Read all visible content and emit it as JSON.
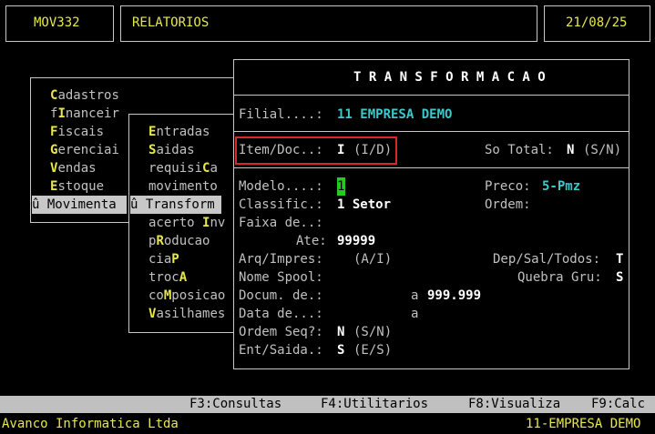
{
  "header": {
    "program": "MOV332",
    "module": "RELATORIOS",
    "date": "21/08/25"
  },
  "menu1": {
    "items": [
      {
        "hot": "C",
        "rest": "adastros"
      },
      {
        "pre": "f",
        "hot": "I",
        "rest": "nanceir"
      },
      {
        "hot": "F",
        "rest": "iscais"
      },
      {
        "hot": "G",
        "rest": "erenciai"
      },
      {
        "hot": "V",
        "rest": "endas"
      },
      {
        "hot": "E",
        "rest": "stoque"
      }
    ],
    "selected": "û Movimenta"
  },
  "menu2": {
    "items": [
      {
        "hot": "E",
        "rest": "ntradas"
      },
      {
        "hot": "S",
        "rest": "aidas"
      },
      {
        "pre": "requisi",
        "hot": "C",
        "rest": "a"
      },
      {
        "pre": "movimento",
        "hot": "",
        "rest": ""
      }
    ],
    "selected": "û Transform",
    "items_after": [
      {
        "pre": "acerto ",
        "hot": "I",
        "rest": "nv"
      },
      {
        "pre": "p",
        "hot": "R",
        "rest": "oducao"
      },
      {
        "pre": "cia",
        "hot": "P",
        "rest": ""
      },
      {
        "pre": "troc",
        "hot": "A",
        "rest": ""
      },
      {
        "pre": "co",
        "hot": "M",
        "rest": "posicao"
      },
      {
        "pre": "",
        "hot": "V",
        "rest": "asilhames"
      }
    ]
  },
  "dialog": {
    "title": "T R A N S F O R M A C A O",
    "filial_label": "Filial....:",
    "filial_value": "11 EMPRESA DEMO",
    "item_label": "Item/Doc..:",
    "item_value": "I",
    "item_hint": "(I/D)",
    "so_total_label": "So Total:",
    "so_total_value": "N",
    "so_total_hint": "(S/N)",
    "modelo_label": "Modelo....:",
    "modelo_value": "1",
    "preco_label": "Preco:",
    "preco_value": "5-Pmz",
    "classific_label": "Classific.:",
    "classific_value": "1 Setor",
    "ordem_label": "Ordem:",
    "faixa_label": "Faixa de..:",
    "ate_label": "Ate:",
    "ate_value": "99999",
    "arq_label": "Arq/Impres:",
    "arq_hint": "(A/I)",
    "dep_label": "Dep/Sal/Todos:",
    "dep_value": "T",
    "nome_spool_label": "Nome Spool:",
    "quebra_label": "Quebra Gru:",
    "quebra_value": "S",
    "docum_label": "Docum. de.:",
    "docum_a": "a",
    "docum_value": "999.999",
    "data_label": "Data de...:",
    "data_a": "a",
    "ordem_seq_label": "Ordem Seq?:",
    "ordem_seq_value": "N",
    "ordem_seq_hint": "(S/N)",
    "ent_label": "Ent/Saida.:",
    "ent_value": "S",
    "ent_hint": "(E/S)"
  },
  "fkeys": [
    "F3:Consultas",
    "F4:Utilitarios",
    "F8:Visualiza",
    "F9:Calc"
  ],
  "status": {
    "left": "Avanco Informatica Ltda",
    "right": "11-EMPRESA DEMO"
  }
}
